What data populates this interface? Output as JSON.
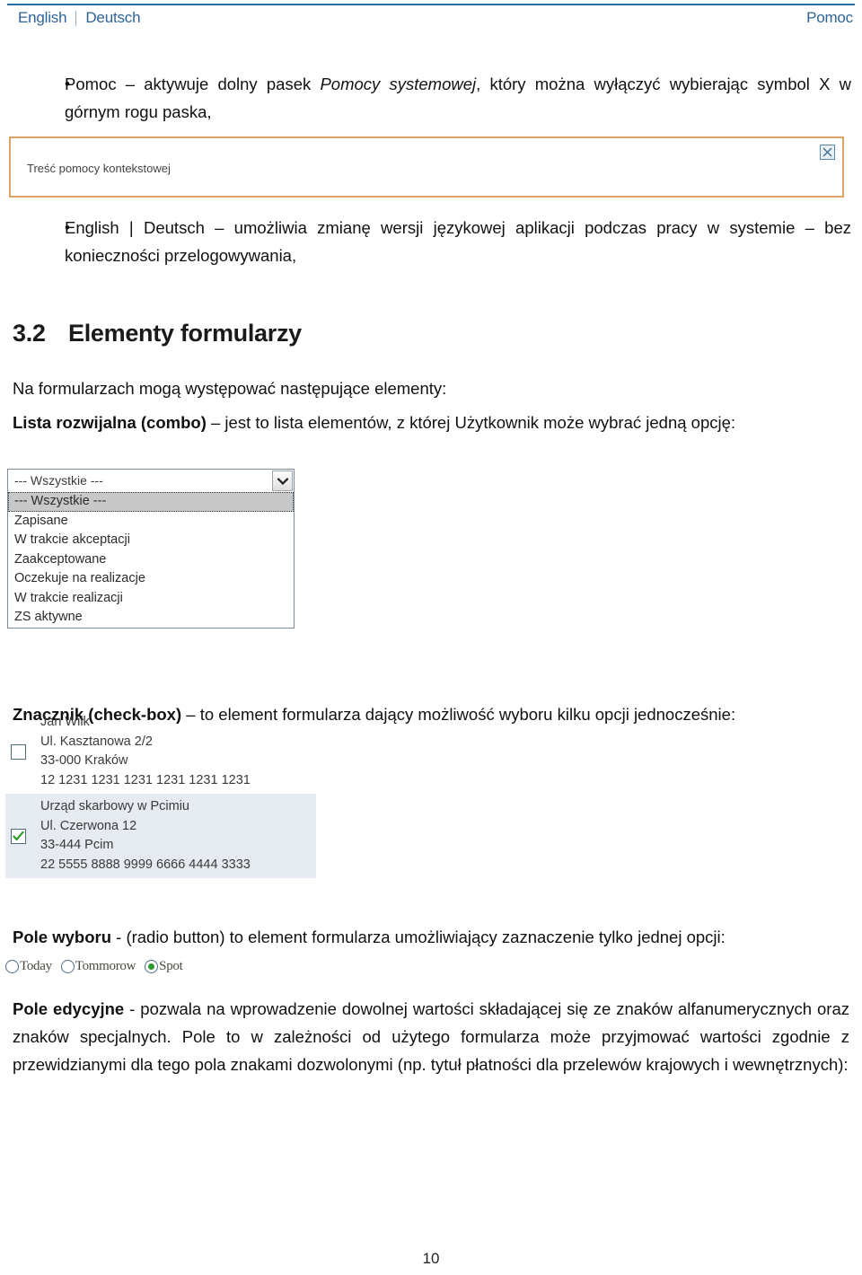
{
  "header": {
    "lang_english": "English",
    "lang_deutsch": "Deutsch",
    "help_link": "Pomoc"
  },
  "bullets": [
    {
      "marker": "•",
      "pre": "Pomoc – aktywuje dolny pasek ",
      "italic": "Pomocy systemowej",
      "post": ", który można wyłączyć wybierając symbol X w górnym rogu paska,"
    },
    {
      "marker": "•",
      "text": "English | Deutsch – umożliwia zmianę wersji językowej aplikacji podczas pracy w systemie – bez konieczności przelogowywania,"
    }
  ],
  "helpbar": {
    "text": "Treść pomocy kontekstowej",
    "close_icon": "close-x-icon",
    "border_color": "#dca368"
  },
  "section": {
    "number": "3.2",
    "title": "Elementy formularzy",
    "intro": "Na formularzach mogą występować następujące elementy:"
  },
  "combo_para": {
    "bold": "Lista rozwijalna (combo)",
    "rest": " – jest to lista elementów, z której Użytkownik może wybrać jedną opcję:"
  },
  "combo": {
    "selected_value": "--- Wszystkie ---",
    "arrow_icon": "chevron-down-icon",
    "options": [
      "--- Wszystkie ---",
      "Zapisane",
      "W trakcie akceptacji",
      "Zaakceptowane",
      "Oczekuje na realizacje",
      "W trakcie realizacji",
      "ZS aktywne"
    ],
    "highlighted_index": 0
  },
  "check_para": {
    "bold": "Znacznik (check-box)",
    "rest": " – to element formularza dający możliwość wyboru kilku opcji jednocześnie:"
  },
  "checklist": [
    {
      "checked": false,
      "highlighted": false,
      "lines": [
        "Jan Wilk",
        "Ul. Kasztanowa 2/2",
        "33-000 Kraków",
        "12 1231 1231 1231 1231 1231 1231"
      ]
    },
    {
      "checked": true,
      "highlighted": true,
      "lines": [
        "Urząd skarbowy w Pcimiu",
        "Ul. Czerwona 12",
        "33-444 Pcim",
        "22 5555 8888 9999 6666 4444 3333"
      ]
    }
  ],
  "radio_para": {
    "bold": "Pole wyboru",
    "rest": " - (radio button) to element formularza umożliwiający zaznaczenie tylko jednej opcji:"
  },
  "radios": [
    {
      "label": "Today",
      "selected": false
    },
    {
      "label": "Tommorow",
      "selected": false
    },
    {
      "label": "Spot",
      "selected": true
    }
  ],
  "edit_para": {
    "bold": "Pole edycyjne",
    "rest": " - pozwala na wprowadzenie dowolnej wartości składającej się ze znaków alfanumerycznych oraz znaków specjalnych. Pole to w zależności od użytego formularza może przyjmować wartości zgodnie z przewidzianymi dla tego pola znakami dozwolonymi (np. tytuł płatności dla przelewów krajowych i wewnętrznych):"
  },
  "footer": {
    "page_number": "10"
  },
  "colors": {
    "link_blue": "#2f6498",
    "rule_blue": "#2e6da4",
    "helpbar_border": "#dca368",
    "row_highlight": "#e5ebf0",
    "check_green": "#2e9b2e"
  }
}
